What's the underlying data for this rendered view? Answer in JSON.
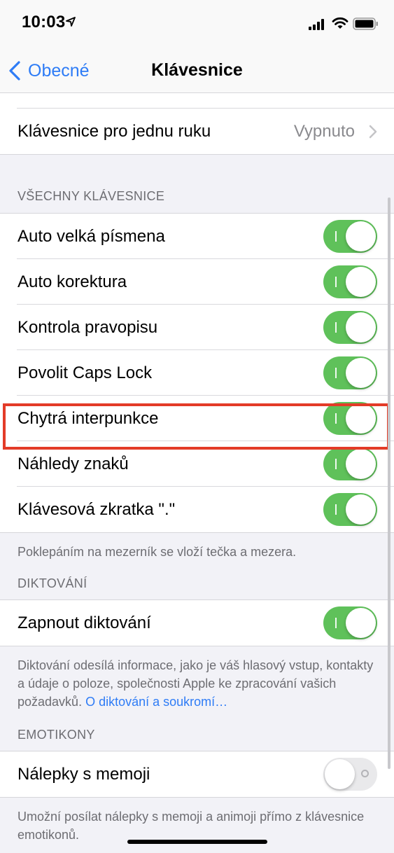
{
  "status": {
    "time": "10:03"
  },
  "nav": {
    "back_label": "Obecné",
    "title": "Klávesnice"
  },
  "one_hand": {
    "label": "Klávesnice pro jednu ruku",
    "value": "Vypnuto"
  },
  "all_keyboards": {
    "header": "VŠECHNY KLÁVESNICE",
    "items": [
      {
        "label": "Auto velká písmena",
        "on": true
      },
      {
        "label": "Auto korektura",
        "on": true
      },
      {
        "label": "Kontrola pravopisu",
        "on": true
      },
      {
        "label": "Povolit Caps Lock",
        "on": true
      },
      {
        "label": "Chytrá interpunkce",
        "on": true
      },
      {
        "label": "Náhledy znaků",
        "on": true
      },
      {
        "label": "Klávesová zkratka \".\"",
        "on": true
      }
    ],
    "footer": "Poklepáním na mezerník se vloží tečka a mezera."
  },
  "dictation": {
    "header": "DIKTOVÁNÍ",
    "item": {
      "label": "Zapnout diktování",
      "on": true
    },
    "footer_text": "Diktování odesílá informace, jako je váš hlasový vstup, kontakty a údaje o poloze, společnosti Apple ke zpracování vašich požadavků.",
    "footer_link": "O diktování a soukromí…"
  },
  "emoji": {
    "header": "EMOTIKONY",
    "item": {
      "label": "Nálepky s memoji",
      "on": false
    },
    "footer": "Umožní posílat nálepky s memoji a animoji přímo z klávesnice emotikonů."
  },
  "colors": {
    "accent": "#2e7cf6",
    "toggle_on": "#5fc15a",
    "highlight": "#e33b28"
  }
}
